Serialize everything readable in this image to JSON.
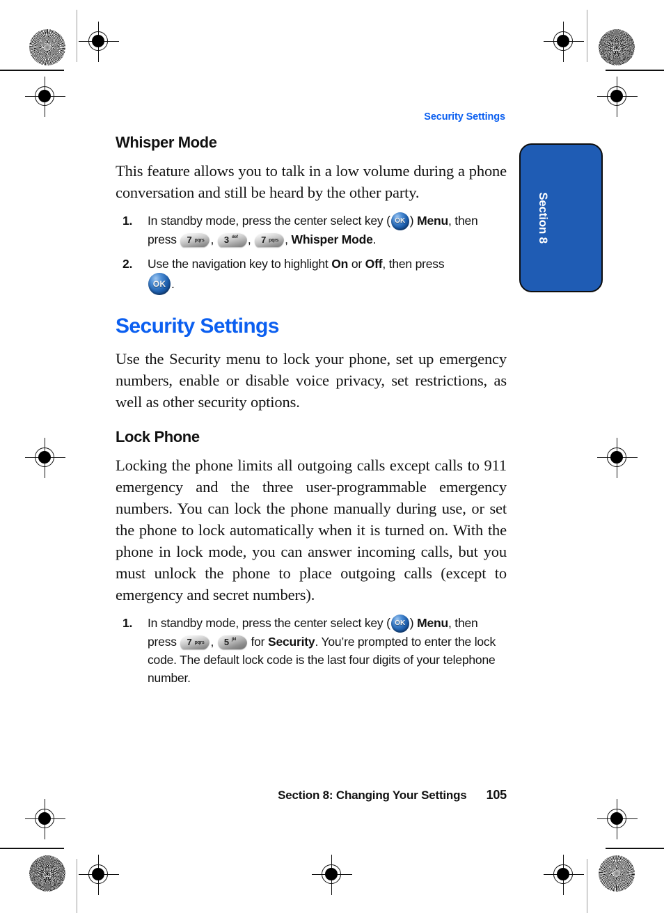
{
  "running_head": "Security Settings",
  "section_tab": {
    "label": "Section 8"
  },
  "sections": [
    {
      "heading": "Whisper Mode",
      "body": "This feature allows you to talk in a low volume during a phone conversation and still be heard by the other party.",
      "steps": [
        {
          "number": "1.",
          "part1": "In standby mode, press the center select key (",
          "part2": ")",
          "part3": "Menu",
          "part4": ", then press",
          "part5": ",",
          "part6": ",",
          "part7": ",",
          "part8": "Whisper Mode",
          "part9": "."
        },
        {
          "number": "2.",
          "part1": "Use the navigation key to highlight",
          "part2": "On",
          "part3": "or",
          "part4": "Off",
          "part5": ", then press",
          "part6": "."
        }
      ]
    },
    {
      "heading": "Security Settings",
      "body": "Use the Security menu to lock your phone, set up emergency numbers, enable or disable voice privacy, set restrictions, as well as other security options.",
      "subsections": [
        {
          "heading": "Lock Phone",
          "body": "Locking the phone limits all outgoing calls except calls to 911 emergency and the three user-programmable emergency numbers. You can lock the phone manually during use, or set the phone to lock automatically when it is turned on. With the phone in lock mode, you can answer incoming calls, but you must unlock the phone to place outgoing calls (except to emergency and secret numbers).",
          "steps": [
            {
              "number": "1.",
              "part1": "In standby mode, press the center select key (",
              "part2": ")",
              "part3": "Menu",
              "part4": ", then press",
              "part5": ",",
              "part6": "for",
              "part7": "Security",
              "part8": ". You’re prompted to enter the lock code. The default lock code is the last four digits of your telephone number."
            }
          ]
        }
      ]
    }
  ],
  "keys": {
    "seven": {
      "digit": "7",
      "letters": "pqrs"
    },
    "three": {
      "digit": "3",
      "letters": "def"
    },
    "five": {
      "digit": "5",
      "letters": "jkl"
    },
    "ok": {
      "label": "OK"
    }
  },
  "footer": {
    "text": "Section 8: Changing Your Settings",
    "page_number": "105"
  },
  "colors": {
    "accent_blue": "#0b5ff0",
    "tab_blue": "#1f5cb4",
    "body_text": "#131313"
  }
}
